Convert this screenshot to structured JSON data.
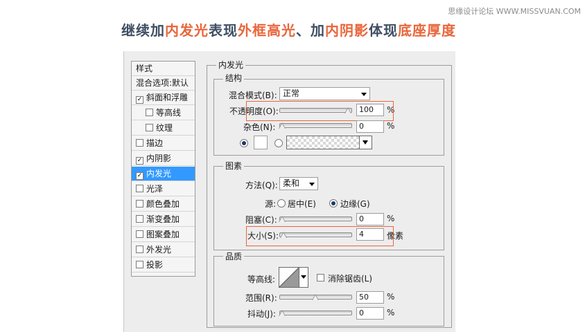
{
  "watermark": "思缘设计论坛 WWW.MISSVUAN.COM",
  "headline": {
    "segments": [
      {
        "text": "继续加",
        "tone": "normal"
      },
      {
        "text": "内发光",
        "tone": "highlight"
      },
      {
        "text": "表现",
        "tone": "normal"
      },
      {
        "text": "外框高光",
        "tone": "highlight"
      },
      {
        "text": "、加",
        "tone": "normal"
      },
      {
        "text": "内阴影",
        "tone": "highlight"
      },
      {
        "text": "体现",
        "tone": "normal"
      },
      {
        "text": "底座厚度",
        "tone": "highlight"
      }
    ]
  },
  "colors": {
    "accent": "#e8663b",
    "title_dark": "#3f4f63",
    "selection": "#3399ff",
    "panel": "#ededed"
  },
  "styles_panel": {
    "header": "样式",
    "blend_default": "混合选项:默认",
    "items": [
      {
        "label": "斜面和浮雕",
        "checked": true,
        "indent": false,
        "selected": false
      },
      {
        "label": "等高线",
        "checked": false,
        "indent": true,
        "selected": false
      },
      {
        "label": "纹理",
        "checked": false,
        "indent": true,
        "selected": false
      },
      {
        "label": "描边",
        "checked": false,
        "indent": false,
        "selected": false
      },
      {
        "label": "内阴影",
        "checked": true,
        "indent": false,
        "selected": false
      },
      {
        "label": "内发光",
        "checked": true,
        "indent": false,
        "selected": true
      },
      {
        "label": "光泽",
        "checked": false,
        "indent": false,
        "selected": false
      },
      {
        "label": "颜色叠加",
        "checked": false,
        "indent": false,
        "selected": false
      },
      {
        "label": "渐变叠加",
        "checked": false,
        "indent": false,
        "selected": false
      },
      {
        "label": "图案叠加",
        "checked": false,
        "indent": false,
        "selected": false
      },
      {
        "label": "外发光",
        "checked": false,
        "indent": false,
        "selected": false
      },
      {
        "label": "投影",
        "checked": false,
        "indent": false,
        "selected": false
      }
    ]
  },
  "inner_glow": {
    "title": "内发光",
    "structure": {
      "title": "结构",
      "blend_mode_label": "混合模式(B):",
      "blend_mode_value": "正常",
      "opacity_label": "不透明度(O):",
      "opacity_value": "100",
      "opacity_fraction": 1.0,
      "opacity_unit": "%",
      "noise_label": "杂色(N):",
      "noise_value": "0",
      "noise_fraction": 0.0,
      "noise_unit": "%"
    },
    "elements": {
      "title": "图素",
      "technique_label": "方法(Q):",
      "technique_value": "柔和",
      "source_label": "源:",
      "source_center": "居中(E)",
      "source_edge": "边缘(G)",
      "choke_label": "阻塞(C):",
      "choke_value": "0",
      "choke_fraction": 0.0,
      "choke_unit": "%",
      "size_label": "大小(S):",
      "size_value": "4",
      "size_fraction": 0.02,
      "size_unit": "像素"
    },
    "quality": {
      "title": "品质",
      "contour_label": "等高线:",
      "antialias_label": "消除锯齿(L)",
      "range_label": "范围(R):",
      "range_value": "50",
      "range_fraction": 0.5,
      "range_unit": "%",
      "jitter_label": "抖动(J):",
      "jitter_value": "0",
      "jitter_fraction": 0.0,
      "jitter_unit": "%"
    }
  }
}
